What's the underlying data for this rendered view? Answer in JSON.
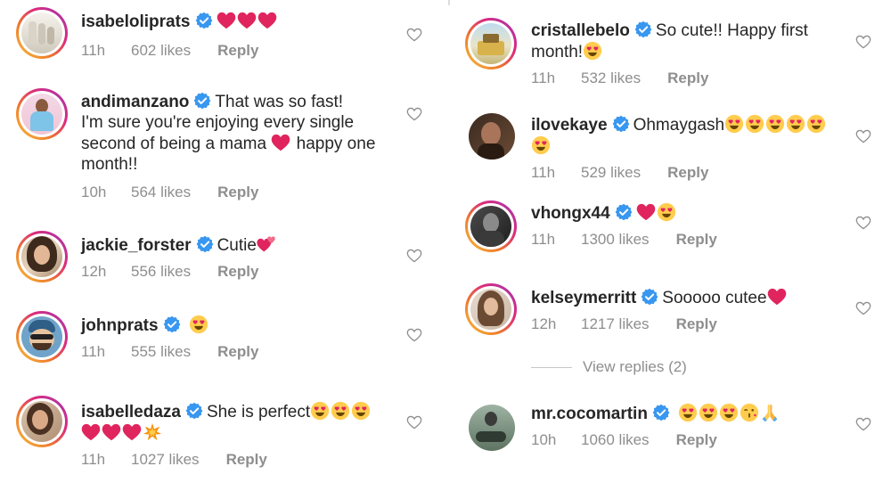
{
  "comments": [
    {
      "username": "isabeloliprats",
      "text": "",
      "time": "11h",
      "likes": "602 likes",
      "reply": "Reply",
      "emojis": [
        "heart",
        "heart",
        "heart"
      ]
    },
    {
      "username": "andimanzano",
      "text_l1": "That was so fast!",
      "text_l2": "I'm sure you're enjoying every single",
      "text_l3": "second of being a mama",
      "text_l3b": "happy one",
      "text_l4": "month!!",
      "time": "10h",
      "likes": "564 likes",
      "reply": "Reply"
    },
    {
      "username": "jackie_forster",
      "text": "Cutie",
      "time": "12h",
      "likes": "556 likes",
      "reply": "Reply"
    },
    {
      "username": "johnprats",
      "text": "",
      "time": "11h",
      "likes": "555 likes",
      "reply": "Reply"
    },
    {
      "username": "isabelledaza",
      "text": "She is perfect",
      "time": "11h",
      "likes": "1027 likes",
      "reply": "Reply"
    },
    {
      "username": "cristallebelo",
      "text_l1": "So cute!! Happy first",
      "text_l2": "month!",
      "time": "11h",
      "likes": "532 likes",
      "reply": "Reply"
    },
    {
      "username": "ilovekaye",
      "text": "Ohmaygash",
      "time": "11h",
      "likes": "529 likes",
      "reply": "Reply"
    },
    {
      "username": "vhongx44",
      "text": "",
      "time": "11h",
      "likes": "1300 likes",
      "reply": "Reply"
    },
    {
      "username": "kelseymerritt",
      "text": "Sooooo cutee",
      "time": "12h",
      "likes": "1217 likes",
      "reply": "Reply"
    },
    {
      "username": "mr.cocomartin",
      "text": "",
      "time": "10h",
      "likes": "1060 likes",
      "reply": "Reply"
    }
  ],
  "view_replies": "View replies (2)",
  "colors": {
    "verified": "#3897f0",
    "heart": "#e0245e",
    "meta": "#8e8e8e",
    "text": "#262626"
  }
}
